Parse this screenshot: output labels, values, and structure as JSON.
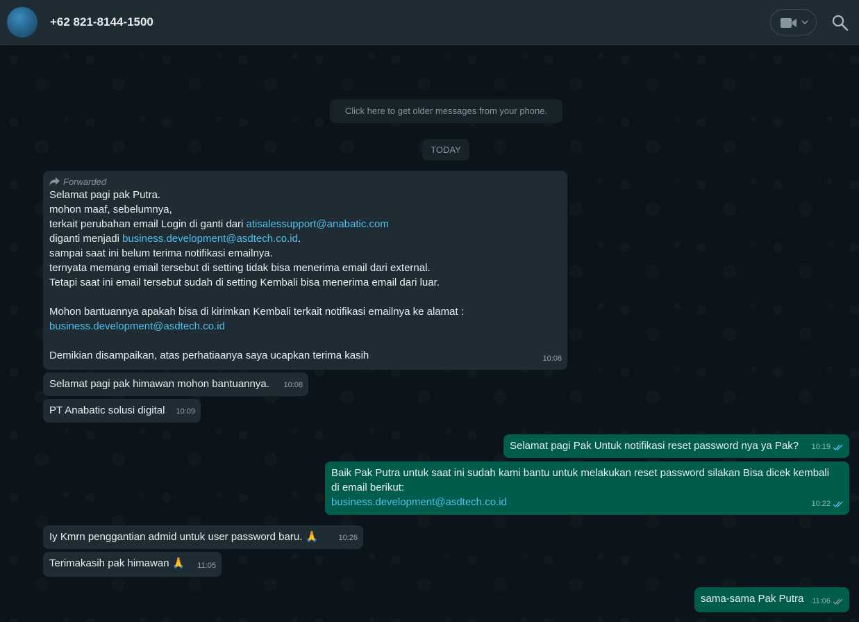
{
  "header": {
    "contact_name": "+62 821-8144-1500"
  },
  "chat": {
    "older_messages": "Click here to get older messages from your phone.",
    "date_chip": "TODAY",
    "messages": [
      {
        "forwarded_label": "Forwarded",
        "line1": "Selamat pagi pak Putra.",
        "line2": "mohon maaf, sebelumnya,",
        "line3a": "terkait perubahan email Login di ganti dari ",
        "line3_link": "atisalessupport@anabatic.com",
        "line4a": "diganti menjadi ",
        "line4_link": "business.development@asdtech.co.id",
        "line4b": ".",
        "line5": "sampai saat ini belum terima notifikasi emailnya.",
        "line6": "ternyata memang email tersebut di setting tidak bisa menerima email dari external.",
        "line7": "Tetapi saat ini email tersebut sudah di setting Kembali bisa menerima email dari luar.",
        "line8": "Mohon bantuannya apakah bisa di kirimkan Kembali terkait notifikasi emailnya ke alamat :",
        "line9_link": "business.development@asdtech.co.id",
        "line10": "Demikian disampaikan, atas perhatiaanya saya ucapkan terima kasih",
        "time": "10:08"
      },
      {
        "text": "Selamat pagi pak himawan mohon bantuannya.",
        "time": "10:08"
      },
      {
        "text": "PT Anabatic solusi digital",
        "time": "10:09"
      },
      {
        "text": "Selamat pagi Pak Untuk notifikasi reset password nya ya Pak?",
        "time": "10:19"
      },
      {
        "line1": "Baik Pak Putra untuk saat ini sudah kami bantu untuk melakukan reset password silakan Bisa dicek kembali",
        "line2": "di email berikut:",
        "link": "business.development@asdtech.co.id",
        "time": "10:22"
      },
      {
        "text": "Iy Kmrn penggantian admid untuk user password baru. 🙏",
        "time": "10:26"
      },
      {
        "text": "Terimakasih pak himawan 🙏",
        "time": "11:05"
      },
      {
        "text": "sama-sama Pak Putra",
        "time": "11:06"
      }
    ]
  },
  "colors": {
    "header_bg": "#202c33",
    "chat_bg": "#0b141a",
    "incoming_bubble": "#202c33",
    "outgoing_bubble": "#005c4b",
    "link": "#53bdeb",
    "read_ticks": "#53bdeb"
  }
}
